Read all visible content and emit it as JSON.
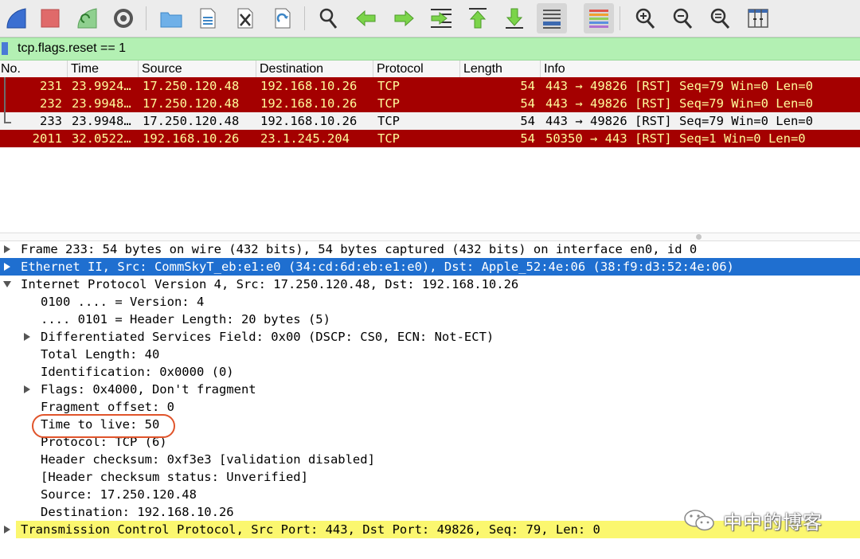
{
  "toolbar": {
    "buttons": [
      {
        "name": "start-capture-icon"
      },
      {
        "name": "stop-capture-icon"
      },
      {
        "name": "restart-capture-icon"
      },
      {
        "name": "capture-options-icon"
      },
      {
        "name": "open-file-icon"
      },
      {
        "name": "save-file-icon"
      },
      {
        "name": "close-file-icon"
      },
      {
        "name": "reload-file-icon"
      },
      {
        "name": "find-packet-icon"
      },
      {
        "name": "go-back-icon"
      },
      {
        "name": "go-forward-icon"
      },
      {
        "name": "go-to-packet-icon"
      },
      {
        "name": "go-first-packet-icon"
      },
      {
        "name": "go-last-packet-icon"
      },
      {
        "name": "autoscroll-icon"
      },
      {
        "name": "colorize-icon"
      },
      {
        "name": "zoom-in-icon"
      },
      {
        "name": "zoom-out-icon"
      },
      {
        "name": "normal-size-icon"
      },
      {
        "name": "resize-columns-icon"
      }
    ]
  },
  "filter": {
    "value": "tcp.flags.reset == 1"
  },
  "columns": [
    "No.",
    "Time",
    "Source",
    "Destination",
    "Protocol",
    "Length",
    "Info"
  ],
  "packets": [
    {
      "no": "231",
      "time": "23.9924…",
      "src": "17.250.120.48",
      "dst": "192.168.10.26",
      "proto": "TCP",
      "len": "54",
      "info": "443 → 49826 [RST] Seq=79 Win=0 Len=0",
      "style": "rst"
    },
    {
      "no": "232",
      "time": "23.9948…",
      "src": "17.250.120.48",
      "dst": "192.168.10.26",
      "proto": "TCP",
      "len": "54",
      "info": "443 → 49826 [RST] Seq=79 Win=0 Len=0",
      "style": "rst"
    },
    {
      "no": "233",
      "time": "23.9948…",
      "src": "17.250.120.48",
      "dst": "192.168.10.26",
      "proto": "TCP",
      "len": "54",
      "info": "443 → 49826 [RST] Seq=79 Win=0 Len=0",
      "style": "sel"
    },
    {
      "no": "2011",
      "time": "32.0522…",
      "src": "192.168.10.26",
      "dst": "23.1.245.204",
      "proto": "TCP",
      "len": "54",
      "info": "50350 → 443 [RST] Seq=1 Win=0 Len=0",
      "style": "rst"
    }
  ],
  "details": [
    {
      "text": "Frame 233: 54 bytes on wire (432 bits), 54 bytes captured (432 bits) on interface en0, id 0",
      "level": 0,
      "expander": "collapsed",
      "style": ""
    },
    {
      "text": "Ethernet II, Src: CommSkyT_eb:e1:e0 (34:cd:6d:eb:e1:e0), Dst: Apple_52:4e:06 (38:f9:d3:52:4e:06)",
      "level": 0,
      "expander": "collapsed",
      "style": "blue"
    },
    {
      "text": "Internet Protocol Version 4, Src: 17.250.120.48, Dst: 192.168.10.26",
      "level": 0,
      "expander": "expanded",
      "style": ""
    },
    {
      "text": "0100 .... = Version: 4",
      "level": 1,
      "expander": "none",
      "style": ""
    },
    {
      "text": ".... 0101 = Header Length: 20 bytes (5)",
      "level": 1,
      "expander": "none",
      "style": ""
    },
    {
      "text": "Differentiated Services Field: 0x00 (DSCP: CS0, ECN: Not-ECT)",
      "level": 1,
      "expander": "collapsed",
      "style": ""
    },
    {
      "text": "Total Length: 40",
      "level": 1,
      "expander": "none",
      "style": ""
    },
    {
      "text": "Identification: 0x0000 (0)",
      "level": 1,
      "expander": "none",
      "style": ""
    },
    {
      "text": "Flags: 0x4000, Don't fragment",
      "level": 1,
      "expander": "collapsed",
      "style": ""
    },
    {
      "text": "Fragment offset: 0",
      "level": 1,
      "expander": "none",
      "style": ""
    },
    {
      "text": "Time to live: 50",
      "level": 1,
      "expander": "none",
      "style": ""
    },
    {
      "text": "Protocol: TCP (6)",
      "level": 1,
      "expander": "none",
      "style": ""
    },
    {
      "text": "Header checksum: 0xf3e3 [validation disabled]",
      "level": 1,
      "expander": "none",
      "style": ""
    },
    {
      "text": "[Header checksum status: Unverified]",
      "level": 1,
      "expander": "none",
      "style": ""
    },
    {
      "text": "Source: 17.250.120.48",
      "level": 1,
      "expander": "none",
      "style": ""
    },
    {
      "text": "Destination: 192.168.10.26",
      "level": 1,
      "expander": "none",
      "style": ""
    },
    {
      "text": "Transmission Control Protocol, Src Port: 443, Dst Port: 49826, Seq: 79, Len: 0",
      "level": 0,
      "expander": "collapsed",
      "style": "yellow"
    }
  ],
  "watermark": {
    "text": "中中的博客"
  },
  "colors": {
    "rst_bg": "#a40000",
    "rst_fg": "#fffc9c",
    "selected_bg": "#1f6fd0",
    "tcp_bg": "#fbf76f",
    "filter_ok_bg": "#b3f0b3",
    "highlight_oval": "#e0542b"
  }
}
